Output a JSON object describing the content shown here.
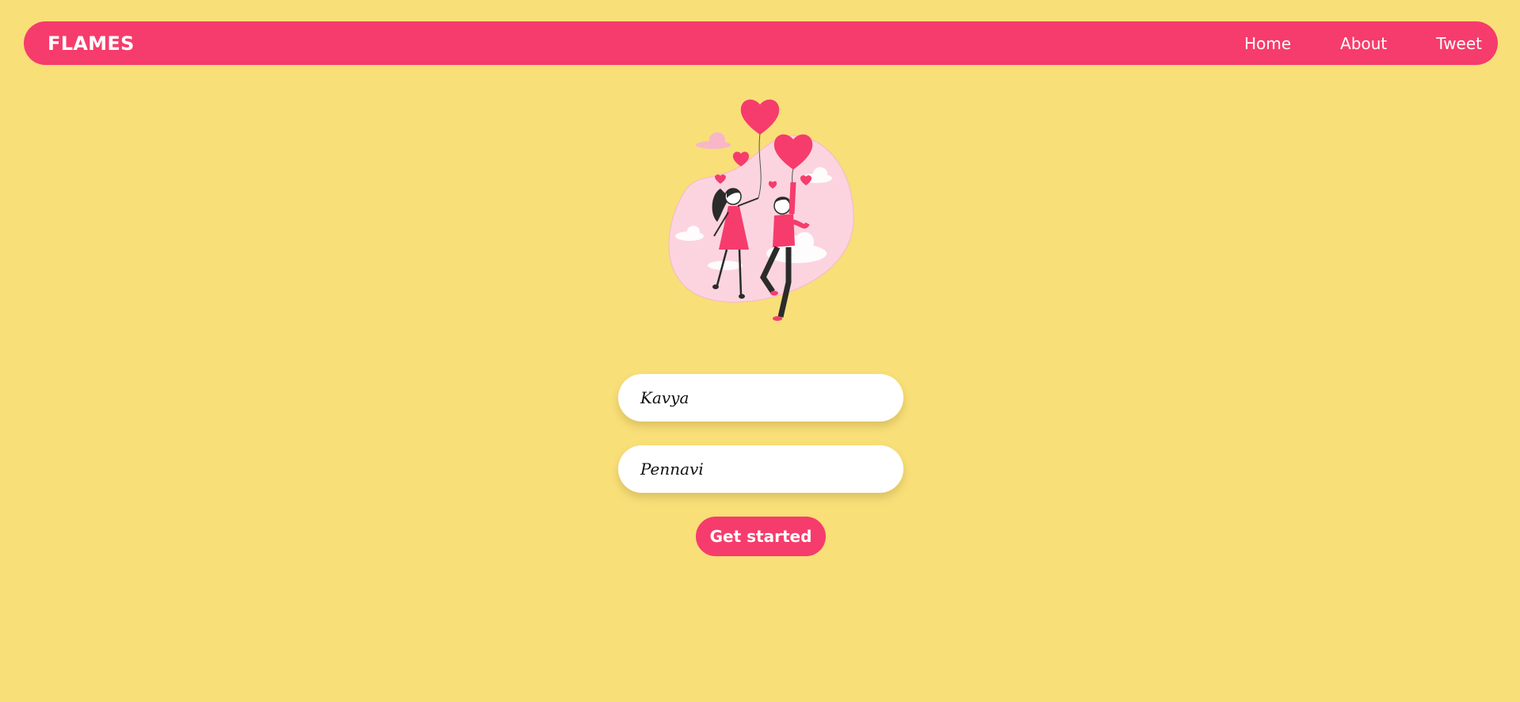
{
  "navbar": {
    "brand": "FLAMES",
    "links": [
      "Home",
      "About",
      "Tweet"
    ]
  },
  "form": {
    "name1_value": "Kavya",
    "name2_value": "Pennavi",
    "submit_label": "Get started"
  },
  "colors": {
    "background": "#f8df78",
    "accent": "#f63c6c",
    "blob": "#fcd4e0"
  },
  "icons": {
    "hero": "couple-with-heart-balloons-illustration"
  }
}
